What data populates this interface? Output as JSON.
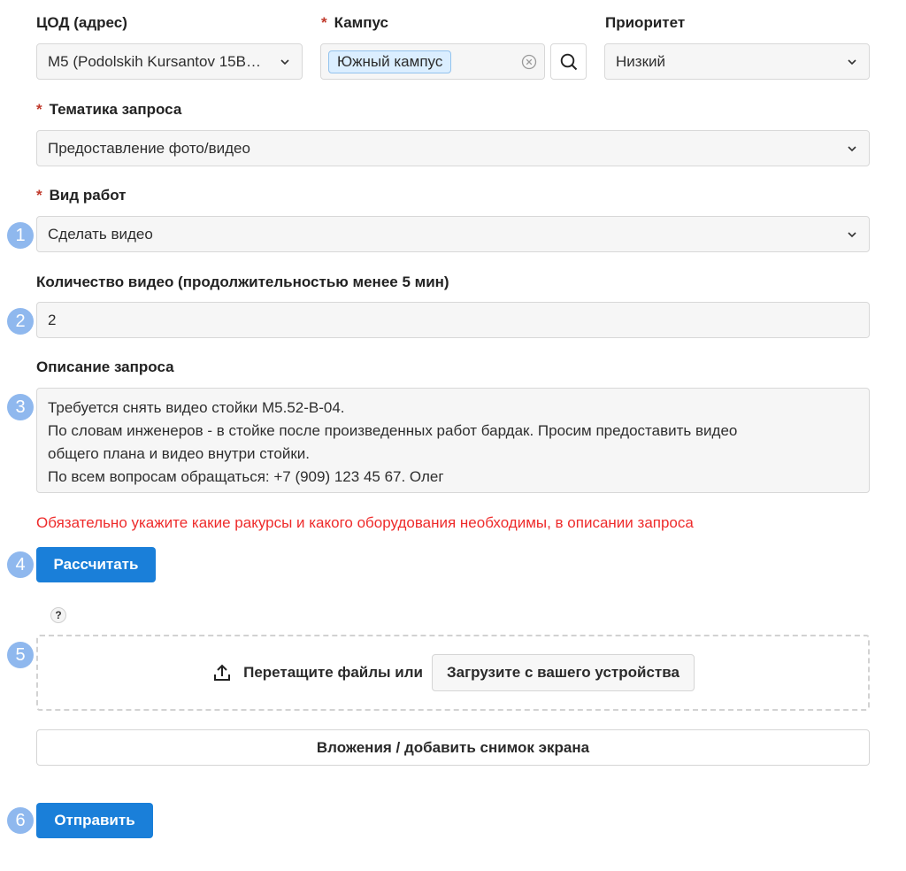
{
  "form": {
    "dc_label": "ЦОД (адрес)",
    "dc_value": "M5 (Podolskih Kursantov 15B…",
    "campus_label": "Кампус",
    "campus_tag": "Южный кампус",
    "priority_label": "Приоритет",
    "priority_value": "Низкий",
    "topic_label": "Тематика запроса",
    "topic_value": "Предоставление фото/видео",
    "work_label": "Вид работ",
    "work_value": "Сделать видео",
    "qty_label": "Количество видео (продолжительностью менее 5 мин)",
    "qty_value": "2",
    "desc_label": "Описание запроса",
    "desc_lines": [
      "Требуется снять видео стойки M5.52-B-04.",
      "По словам инженеров - в стойке после произведенных работ бардак. Просим предоставить видео",
      "общего плана и видео внутри стойки.",
      "По всем вопросам обращаться: +7 (909) 123 45 67. Олег"
    ],
    "required_mark": "*",
    "warning": "Обязательно укажите какие ракурсы и какого оборудования необходимы, в описании запроса",
    "calc_button": "Рассчитать",
    "help_mark": "?",
    "drop_text": "Перетащите файлы или",
    "upload_button": "Загрузите с вашего устройства",
    "attachments_button": "Вложения / добавить снимок экрана",
    "submit_button": "Отправить"
  },
  "badges": [
    "1",
    "2",
    "3",
    "4",
    "5",
    "6"
  ],
  "colors": {
    "primary": "#1a7fd9",
    "warning": "#ee2b2b",
    "required": "#c0392b",
    "badge": "#8fb8ee",
    "tag_bg": "#dbeeff"
  }
}
